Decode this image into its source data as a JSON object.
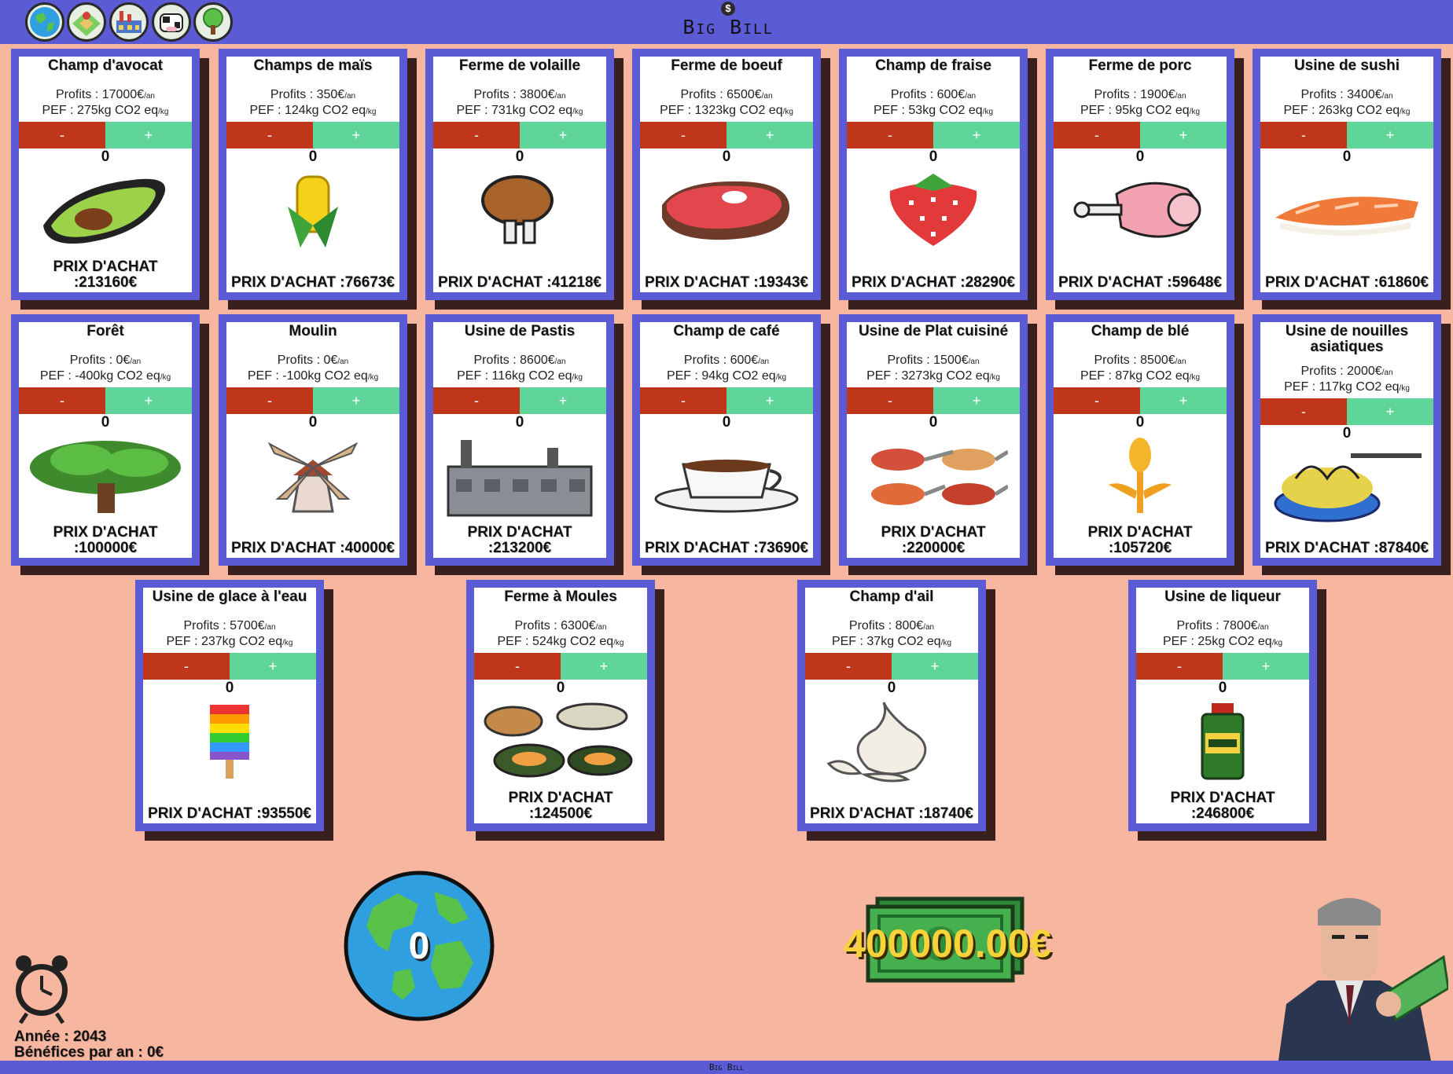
{
  "app": {
    "logo_text": "Big Bill",
    "logo_coin": "$",
    "footer_text": "Big Bill"
  },
  "nav": [
    {
      "name": "globe-nav-icon"
    },
    {
      "name": "map-nav-icon"
    },
    {
      "name": "factory-nav-icon"
    },
    {
      "name": "cow-nav-icon"
    },
    {
      "name": "tree-nav-icon"
    }
  ],
  "labels": {
    "minus": "-",
    "plus": "+",
    "profits_prefix": "Profits : ",
    "profits_unit": "/an",
    "pef_prefix": "PEF : ",
    "pef_unit": "/kg",
    "price_prefix": "PRIX D'ACHAT :"
  },
  "cards": [
    {
      "title": "Champ d'avocat",
      "profits": "17000€",
      "pef": "275kg CO2 eq",
      "qty": "0",
      "price": "213160€",
      "icon": "avocado-icon"
    },
    {
      "title": "Champs de maïs",
      "profits": "350€",
      "pef": "124kg CO2 eq",
      "qty": "0",
      "price": "76673€",
      "icon": "corn-icon"
    },
    {
      "title": "Ferme de volaille",
      "profits": "3800€",
      "pef": "731kg CO2 eq",
      "qty": "0",
      "price": "41218€",
      "icon": "chicken-leg-icon"
    },
    {
      "title": "Ferme de boeuf",
      "profits": "6500€",
      "pef": "1323kg CO2 eq",
      "qty": "0",
      "price": "19343€",
      "icon": "steak-icon"
    },
    {
      "title": "Champ de fraise",
      "profits": "600€",
      "pef": "53kg CO2 eq",
      "qty": "0",
      "price": "28290€",
      "icon": "strawberry-icon"
    },
    {
      "title": "Ferme de porc",
      "profits": "1900€",
      "pef": "95kg CO2 eq",
      "qty": "0",
      "price": "59648€",
      "icon": "ham-icon"
    },
    {
      "title": "Usine de sushi",
      "profits": "3400€",
      "pef": "263kg CO2 eq",
      "qty": "0",
      "price": "61860€",
      "icon": "sushi-icon"
    },
    {
      "title": "Forêt",
      "profits": "0€",
      "pef": "-400kg CO2 eq",
      "qty": "0",
      "price": "100000€",
      "icon": "tree-icon"
    },
    {
      "title": "Moulin",
      "profits": "0€",
      "pef": "-100kg CO2 eq",
      "qty": "0",
      "price": "40000€",
      "icon": "windmill-icon"
    },
    {
      "title": "Usine de Pastis",
      "profits": "8600€",
      "pef": "116kg CO2 eq",
      "qty": "0",
      "price": "213200€",
      "icon": "factory-icon"
    },
    {
      "title": "Champ de café",
      "profits": "600€",
      "pef": "94kg CO2 eq",
      "qty": "0",
      "price": "73690€",
      "icon": "coffee-cup-icon"
    },
    {
      "title": "Usine de Plat cuisiné",
      "profits": "1500€",
      "pef": "3273kg CO2 eq",
      "qty": "0",
      "price": "220000€",
      "icon": "cooked-dishes-icon"
    },
    {
      "title": "Champ de blé",
      "profits": "8500€",
      "pef": "87kg CO2 eq",
      "qty": "0",
      "price": "105720€",
      "icon": "wheat-icon"
    },
    {
      "title": "Usine de nouilles asiatiques",
      "profits": "2000€",
      "pef": "117kg CO2 eq",
      "qty": "0",
      "price": "87840€",
      "icon": "noodles-icon"
    },
    {
      "title": "Usine de glace à l'eau",
      "profits": "5700€",
      "pef": "237kg CO2 eq",
      "qty": "0",
      "price": "93550€",
      "icon": "popsicle-icon"
    },
    {
      "title": "Ferme à Moules",
      "profits": "6300€",
      "pef": "524kg CO2 eq",
      "qty": "0",
      "price": "124500€",
      "icon": "mussels-icon"
    },
    {
      "title": "Champ d'ail",
      "profits": "800€",
      "pef": "37kg CO2 eq",
      "qty": "0",
      "price": "18740€",
      "icon": "garlic-icon"
    },
    {
      "title": "Usine de liqueur",
      "profits": "7800€",
      "pef": "25kg CO2 eq",
      "qty": "0",
      "price": "246800€",
      "icon": "liqueur-bottle-icon"
    }
  ],
  "status": {
    "co2_counter": "0",
    "money": "400000.00€",
    "year_label": "Année : 2043",
    "profits_label": "Bénéfices par an : 0€"
  },
  "colors": {
    "bar": "#5b5bd6",
    "background": "#f7b6a0",
    "minus": "#c0361a",
    "plus": "#5fd59a",
    "money": "#f7d23a"
  }
}
